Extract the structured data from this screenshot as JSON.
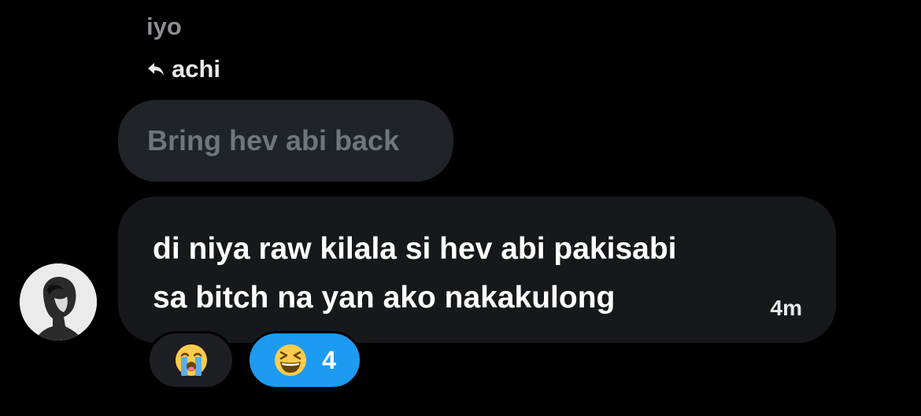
{
  "thread": {
    "sender_name": "iyo",
    "reply_to": "achi",
    "quoted_message": "Bring hev abi back"
  },
  "message": {
    "lines": [
      "di niya raw kilala si hev abi pakisabi",
      "sa bitch na yan ako nakakulong"
    ],
    "timestamp": "4m",
    "avatar_icon": "profile-photo-icon"
  },
  "reactions": [
    {
      "emoji": "😭",
      "icon": "loudly-crying-face-icon",
      "count": "",
      "active": false
    },
    {
      "emoji": "😆",
      "icon": "grinning-squinting-face-icon",
      "count": "4",
      "active": true
    }
  ],
  "colors": {
    "background": "#000000",
    "quoted_bubble": "#202327",
    "message_bubble": "#16181c",
    "active_reaction": "#1d9bf0",
    "muted_text": "#71767b"
  }
}
